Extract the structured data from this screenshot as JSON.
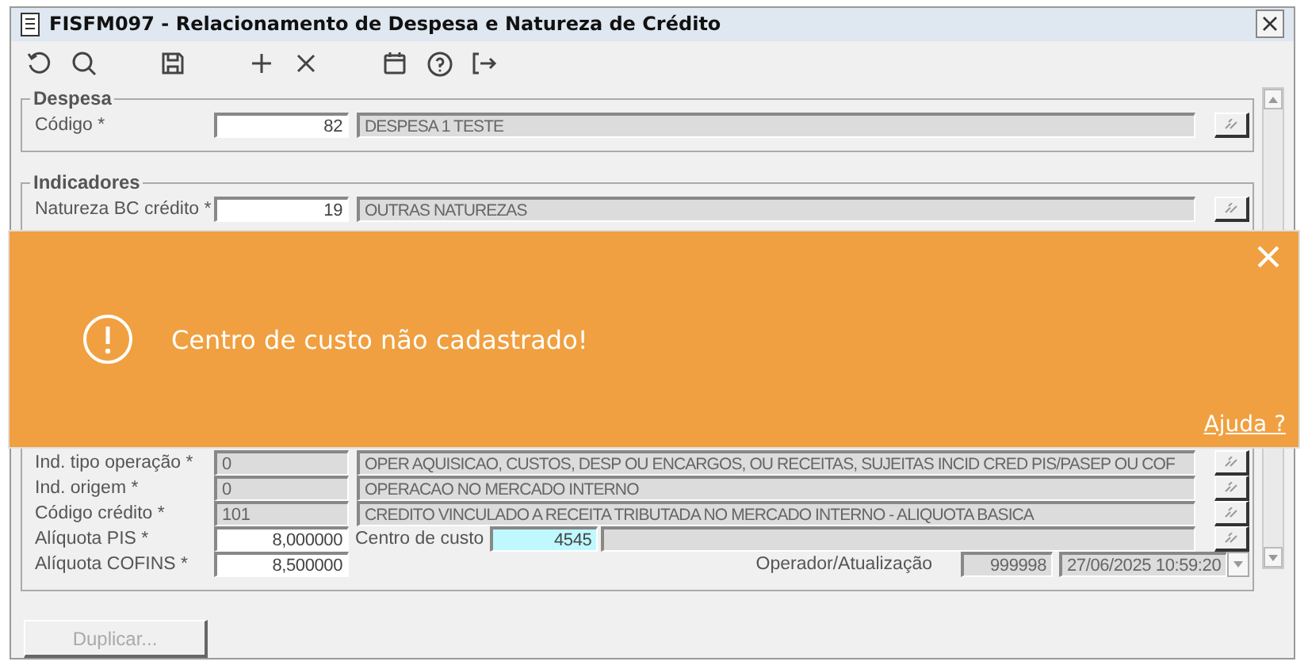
{
  "window": {
    "title": "FISFM097 - Relacionamento de Despesa e Natureza de Crédito"
  },
  "toolbar": [
    {
      "kind": "undo"
    },
    {
      "kind": "search"
    },
    {
      "kind": "gap"
    },
    {
      "kind": "save"
    },
    {
      "kind": "gap"
    },
    {
      "kind": "add"
    },
    {
      "kind": "delete"
    },
    {
      "kind": "gap"
    },
    {
      "kind": "calendar"
    },
    {
      "kind": "help"
    },
    {
      "kind": "exit"
    }
  ],
  "despesa": {
    "title": "Despesa",
    "label": "Código *",
    "code": "82",
    "description": "DESPESA 1 TESTE"
  },
  "indicadores": {
    "title": "Indicadores",
    "top_rows": [
      {
        "label": "Natureza BC crédito *",
        "code": "19",
        "editable": true,
        "description": "OUTRAS NATUREZAS"
      }
    ],
    "rows": [
      {
        "label": "Ind. tipo operação *",
        "code": "0",
        "editable": false,
        "description": "OPER AQUISICAO, CUSTOS, DESP OU ENCARGOS, OU RECEITAS, SUJEITAS INCID CRED PIS/PASEP OU COF"
      },
      {
        "label": "Ind. origem *",
        "code": "0",
        "editable": false,
        "description": "OPERACAO NO MERCADO INTERNO"
      },
      {
        "label": "Código crédito *",
        "code": "101",
        "editable": false,
        "description": "CREDITO VINCULADO A RECEITA TRIBUTADA NO MERCADO INTERNO - ALIQUOTA BASICA"
      }
    ],
    "pis": {
      "label": "Alíquota PIS *",
      "value": "8,000000",
      "cost_center_label": "Centro de custo",
      "cost_center": "4545"
    },
    "cofins": {
      "label": "Alíquota COFINS *",
      "value": "8,500000",
      "operator_label": "Operador/Atualização",
      "operator": "999998",
      "updated": "27/06/2025 10:59:20"
    }
  },
  "buttons": [
    {
      "label": "Duplicar...",
      "disabled": true
    }
  ],
  "toast": {
    "message": "Centro de custo não cadastrado!",
    "help_link": "Ajuda ?"
  }
}
